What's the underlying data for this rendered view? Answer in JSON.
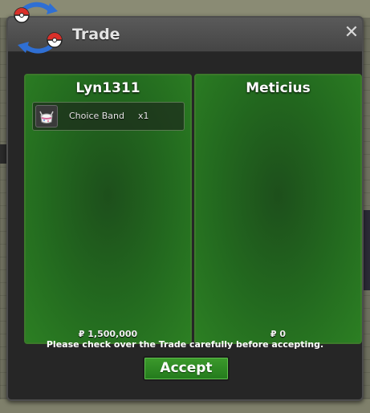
{
  "window": {
    "title": "Trade",
    "close_glyph": "✕"
  },
  "left_panel": {
    "player_name": "Lyn1311",
    "items": [
      {
        "name": "Choice Band",
        "quantity": "x1",
        "icon": "choice-band-icon"
      }
    ],
    "money": "₽ 1,500,000"
  },
  "right_panel": {
    "player_name": "Meticius",
    "items": [],
    "money": "₽ 0"
  },
  "footer": {
    "notice": "Please check over the Trade carefully before accepting.",
    "accept_label": "Accept"
  },
  "colors": {
    "panel_green": "#236a1f",
    "accept_green": "#3c9a2c",
    "window_bg": "#262626"
  }
}
